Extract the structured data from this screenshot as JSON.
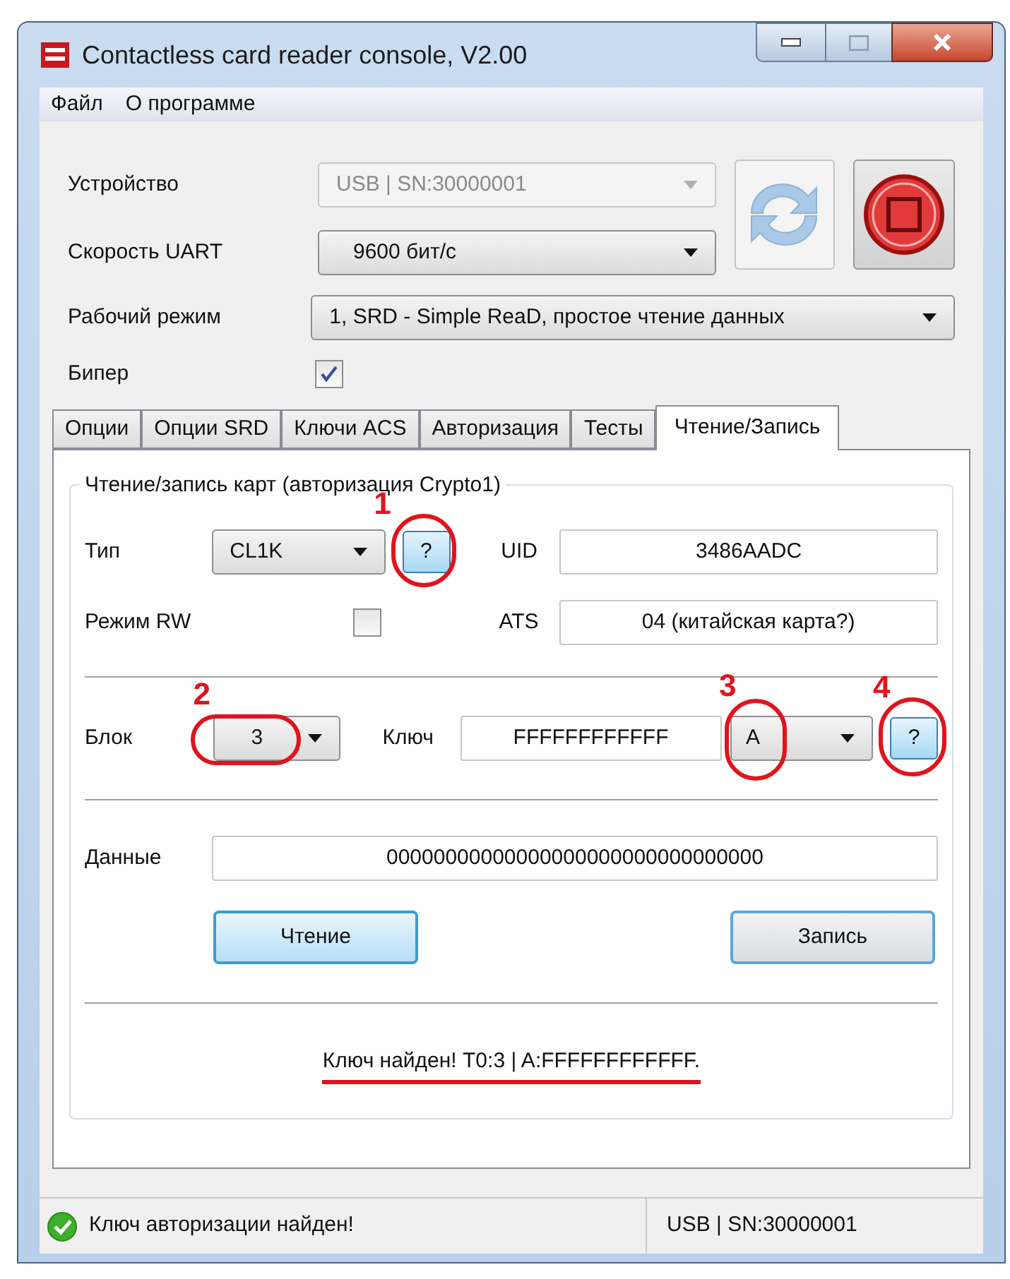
{
  "window": {
    "title": "Contactless card reader console, V2.00"
  },
  "menu": [
    "Файл",
    "О программе"
  ],
  "device": {
    "label": "Устройство",
    "value": "USB | SN:30000001",
    "disabled": true
  },
  "uart": {
    "label": "Скорость UART",
    "value": "9600 бит/с",
    "disabled": false
  },
  "mode": {
    "label": "Рабочий режим",
    "value": "1, SRD - Simple ReaD, простое чтение данных",
    "disabled": false
  },
  "beeper": {
    "label": "Бипер",
    "checked": true
  },
  "tabs": [
    {
      "label": "Опции",
      "selected": false
    },
    {
      "label": "Опции SRD",
      "selected": false
    },
    {
      "label": "Ключи ACS",
      "selected": false
    },
    {
      "label": "Авторизация",
      "selected": false
    },
    {
      "label": "Тесты",
      "selected": false
    },
    {
      "label": "Чтение/Запись",
      "selected": true
    }
  ],
  "group": {
    "title": "Чтение/запись карт (авторизация Crypto1)",
    "type": {
      "label": "Тип",
      "value": "CL1K",
      "help": "?"
    },
    "uid": {
      "label": "UID",
      "value": "3486AADC"
    },
    "rw": {
      "label": "Режим RW",
      "checked": false
    },
    "ats": {
      "label": "ATS",
      "value": "04 (китайская карта?)"
    },
    "block": {
      "label": "Блок",
      "value": "3"
    },
    "key": {
      "label": "Ключ",
      "value": "FFFFFFFFFFFF"
    },
    "key_type": {
      "value": "A",
      "help": "?"
    },
    "data": {
      "label": "Данные",
      "value": "00000000000000000000000000000000"
    },
    "buttons": [
      "Чтение",
      "Запись"
    ],
    "result": "Ключ найден! T0:3 | A:FFFFFFFFFFFF."
  },
  "annotations": [
    "1",
    "2",
    "3",
    "4"
  ],
  "status_bar": {
    "message": "Ключ авторизации найден!",
    "connection": "USB | SN:30000001"
  }
}
